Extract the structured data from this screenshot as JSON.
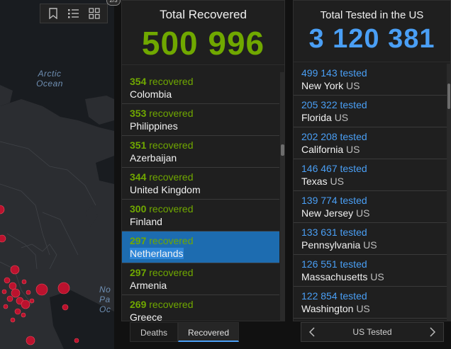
{
  "map": {
    "ocean_arctic": "Arctic\nOcean",
    "ocean_pacific": "No\nPa\nOc",
    "collapse_badge": "2/3",
    "toolbar": {
      "icons": [
        "bookmark-icon",
        "legend-list-icon",
        "basemap-gallery-icon"
      ]
    },
    "colors": {
      "land": "#2b2d31",
      "water": "#191c20",
      "case_marker": "#c8102e"
    }
  },
  "recovered": {
    "title": "Total Recovered",
    "total": "500 996",
    "unit": "recovered",
    "items": [
      {
        "count": "354",
        "name": "Colombia",
        "selected": false
      },
      {
        "count": "353",
        "name": "Philippines",
        "selected": false
      },
      {
        "count": "351",
        "name": "Azerbaijan",
        "selected": false
      },
      {
        "count": "344",
        "name": "United Kingdom",
        "selected": false
      },
      {
        "count": "300",
        "name": "Finland",
        "selected": false
      },
      {
        "count": "297",
        "name": "Netherlands",
        "selected": true
      },
      {
        "count": "297",
        "name": "Armenia",
        "selected": false
      },
      {
        "count": "269",
        "name": "Greece",
        "selected": false
      }
    ]
  },
  "tested": {
    "title": "Total Tested in the US",
    "total": "3 120 381",
    "unit": "tested",
    "country": "US",
    "items": [
      {
        "count": "499 143",
        "name": "New York"
      },
      {
        "count": "205 322",
        "name": "Florida"
      },
      {
        "count": "202 208",
        "name": "California"
      },
      {
        "count": "146 467",
        "name": "Texas"
      },
      {
        "count": "139 774",
        "name": "New Jersey"
      },
      {
        "count": "133 631",
        "name": "Pennsylvania"
      },
      {
        "count": "126 551",
        "name": "Massachusetts"
      },
      {
        "count": "122 854",
        "name": "Washington"
      }
    ]
  },
  "tabs": {
    "deaths": "Deaths",
    "recovered": "Recovered",
    "active": "recovered"
  },
  "pager": {
    "label": "US Tested",
    "prev_icon": "chevron-left-icon",
    "next_icon": "chevron-right-icon"
  },
  "colors": {
    "recovered_green": "#70a800",
    "tested_blue": "#4a9ff5",
    "selected_row": "#1d6cb0"
  }
}
